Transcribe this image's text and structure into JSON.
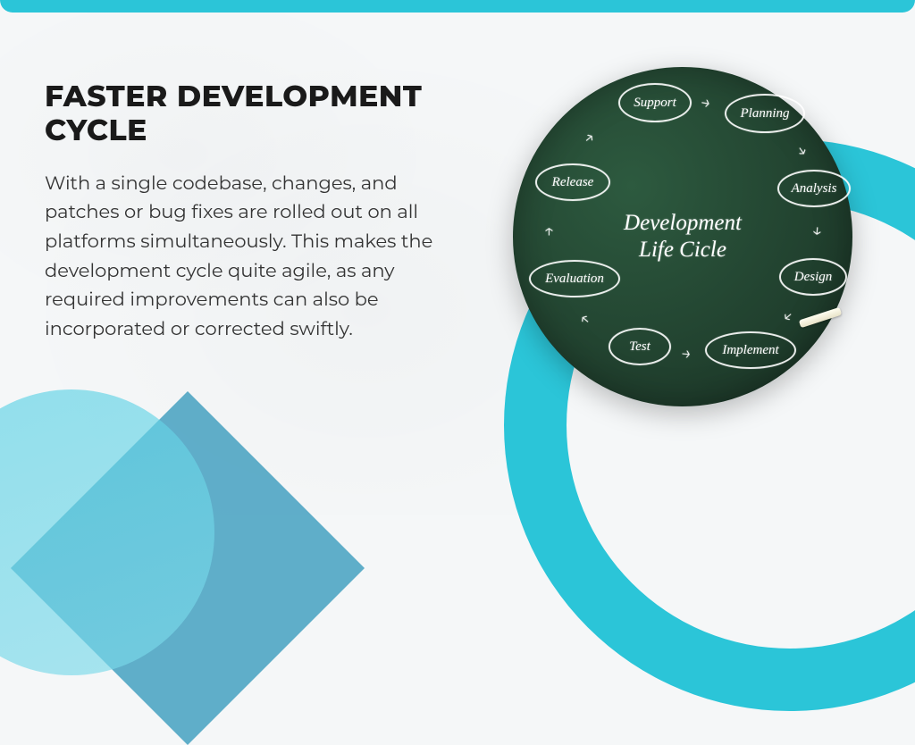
{
  "slide": {
    "title": "FASTER DEVELOPMENT CYCLE",
    "body": "With a single codebase, changes, and patches or bug fixes are rolled out on all platforms simultaneously. This makes the development cycle quite agile, as any required improvements can also be incorporated or corrected swiftly."
  },
  "diagram": {
    "center_line1": "Development",
    "center_line2": "Life Cicle",
    "phases": {
      "planning": "Planning",
      "analysis": "Analysis",
      "design": "Design",
      "implement": "Implement",
      "test": "Test",
      "evaluation": "Evaluation",
      "release": "Release",
      "support": "Support"
    }
  }
}
